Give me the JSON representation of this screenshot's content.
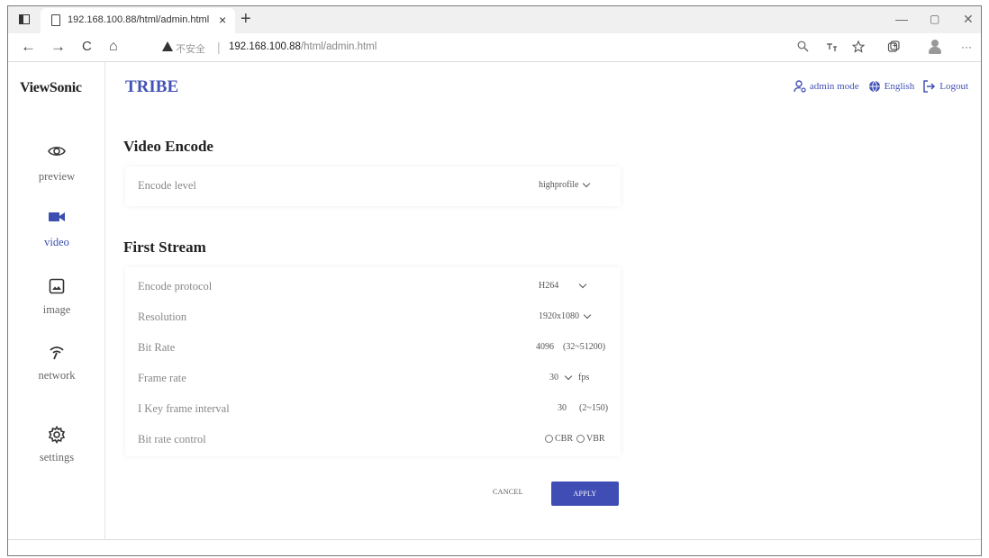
{
  "browser": {
    "tab_title": "192.168.100.88/html/admin.html",
    "tab_close": "×",
    "new_tab": "+",
    "win_minimize": "—",
    "win_maximize": "▢",
    "win_close": "✕",
    "back": "←",
    "forward": "→",
    "reload": "C",
    "home": "⌂",
    "insecure_label": "不安全",
    "separator": "|",
    "url_host": "192.168.100.88",
    "url_path": "/html/admin.html",
    "tools": [
      "zoom-icon",
      "read-aloud-icon",
      "favorites-icon",
      "collections-icon",
      "profile-icon",
      "more-icon"
    ],
    "more": "···"
  },
  "sidebar": {
    "logo": "ViewSonic",
    "items": [
      {
        "label": "preview",
        "icon": "eye-icon"
      },
      {
        "label": "video",
        "icon": "video-camera-icon",
        "active": true
      },
      {
        "label": "image",
        "icon": "image-icon"
      },
      {
        "label": "network",
        "icon": "wifi-icon"
      },
      {
        "label": "settings",
        "icon": "gear-icon"
      }
    ]
  },
  "header": {
    "brand": "TRIBE",
    "admin_mode": "admin mode",
    "language": "English",
    "logout": "Logout"
  },
  "video_encode": {
    "title": "Video Encode",
    "encode_level_label": "Encode level",
    "encode_level_value": "highprofile"
  },
  "first_stream": {
    "title": "First Stream",
    "encode_protocol_label": "Encode protocol",
    "encode_protocol_value": "H264",
    "resolution_label": "Resolution",
    "resolution_value": "1920x1080",
    "bitrate_label": "Bit Rate",
    "bitrate_value": "4096",
    "bitrate_range": "(32~51200)",
    "framerate_label": "Frame rate",
    "framerate_value": "30",
    "framerate_unit": "fps",
    "keyframe_label": "I Key frame interval",
    "keyframe_value": "30",
    "keyframe_range": "(2~150)",
    "bitrate_control_label": "Bit rate control",
    "cbr": "CBR",
    "vbr": "VBR"
  },
  "actions": {
    "cancel": "CANCEL",
    "apply": "APPLY"
  },
  "colors": {
    "accent": "#3f4db5",
    "brand": "#4352b5"
  }
}
